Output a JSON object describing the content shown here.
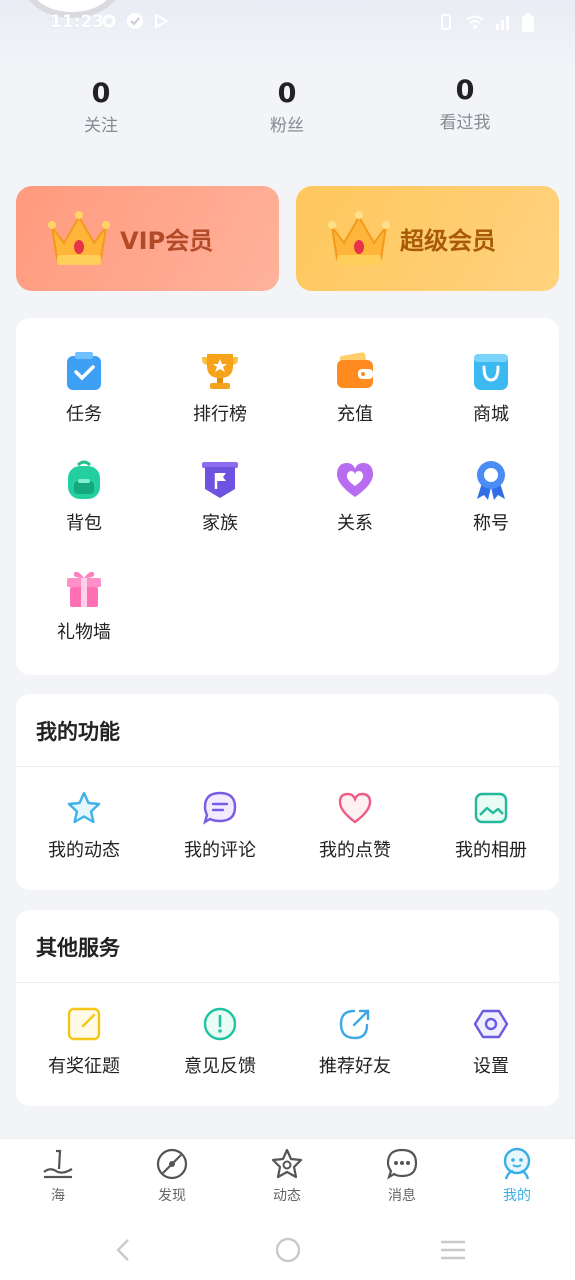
{
  "status_bar": {
    "time": "11:23",
    "left_icons": [
      "gear-icon",
      "check-badge-icon",
      "play-icon"
    ],
    "right_icons": [
      "vibrate-icon",
      "wifi-icon",
      "signal-icon",
      "battery-icon"
    ]
  },
  "stats": [
    {
      "value": "0",
      "label": "关注"
    },
    {
      "value": "0",
      "label": "粉丝"
    },
    {
      "value": "0",
      "label": "看过我"
    }
  ],
  "membership": {
    "vip_label": "VIP会员",
    "super_label": "超级会员",
    "vip_color": "#ff9a7d",
    "super_color": "#ffc75c"
  },
  "grid": [
    {
      "label": "任务",
      "icon": "task-icon"
    },
    {
      "label": "排行榜",
      "icon": "trophy-icon"
    },
    {
      "label": "充值",
      "icon": "wallet-icon"
    },
    {
      "label": "商城",
      "icon": "shopping-bag-icon"
    },
    {
      "label": "背包",
      "icon": "backpack-icon"
    },
    {
      "label": "家族",
      "icon": "family-flag-icon"
    },
    {
      "label": "关系",
      "icon": "heart-icon"
    },
    {
      "label": "称号",
      "icon": "badge-ribbon-icon"
    },
    {
      "label": "礼物墙",
      "icon": "gift-icon"
    }
  ],
  "my_functions": {
    "title": "我的功能",
    "items": [
      {
        "label": "我的动态",
        "icon": "star-icon"
      },
      {
        "label": "我的评论",
        "icon": "comment-icon"
      },
      {
        "label": "我的点赞",
        "icon": "like-heart-icon"
      },
      {
        "label": "我的相册",
        "icon": "album-icon"
      }
    ]
  },
  "other_services": {
    "title": "其他服务",
    "items": [
      {
        "label": "有奖征题",
        "icon": "edit-icon"
      },
      {
        "label": "意见反馈",
        "icon": "feedback-icon"
      },
      {
        "label": "推荐好友",
        "icon": "share-icon"
      },
      {
        "label": "设置",
        "icon": "settings-icon"
      }
    ]
  },
  "tabs": [
    {
      "label": "海",
      "icon": "sea-icon"
    },
    {
      "label": "发现",
      "icon": "discover-icon"
    },
    {
      "label": "动态",
      "icon": "moments-icon"
    },
    {
      "label": "消息",
      "icon": "message-icon"
    },
    {
      "label": "我的",
      "icon": "profile-icon",
      "active": true
    }
  ],
  "colors": {
    "accent": "#3aaee6",
    "background": "#f3f4f8"
  }
}
